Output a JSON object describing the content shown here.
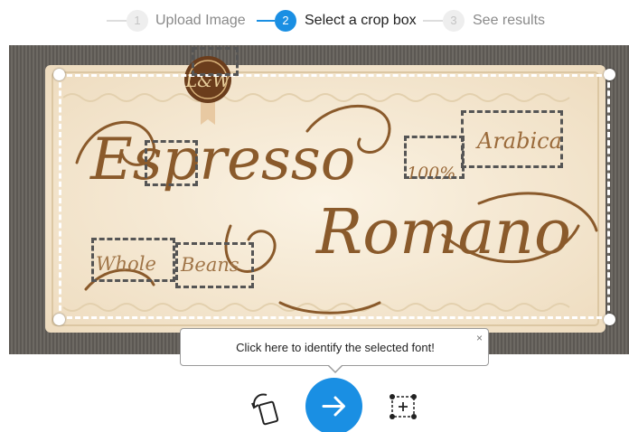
{
  "stepper": {
    "steps": [
      {
        "number": "1",
        "label": "Upload Image"
      },
      {
        "number": "2",
        "label": "Select a crop box"
      },
      {
        "number": "3",
        "label": "See results"
      }
    ]
  },
  "colors": {
    "accent": "#1a8fe3",
    "label_brown": "#7a4f26",
    "cream": "#f6ebd7"
  },
  "image": {
    "logo_text": "L&W",
    "words": [
      "Espresso",
      "Romano",
      "100%",
      "Arabica",
      "Whole",
      "Beans"
    ]
  },
  "tooltip": {
    "text": "Click here to identify the selected font!",
    "close": "×"
  },
  "toolbar": {
    "rotate_icon": "rotate-icon",
    "next_icon": "arrow-right-icon",
    "add_box_icon": "add-box-icon"
  }
}
